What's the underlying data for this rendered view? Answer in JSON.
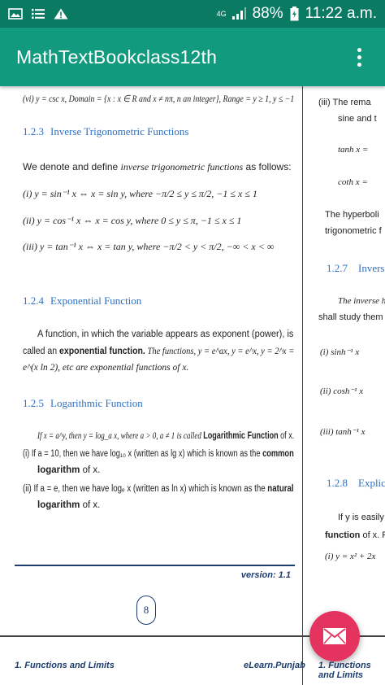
{
  "status_bar": {
    "network": "4G",
    "battery": "88%",
    "time": "11:22 a.m."
  },
  "app_bar": {
    "title": "MathTextBookclass12th"
  },
  "page": {
    "line_vi": "(vi)   y = csc x, Domain = {x : x ∈ R and x ≠ nπ, n an integer}, Range = y ≥ 1, y ≤ −1",
    "s123_num": "1.2.3",
    "s123_title": "Inverse Trigonometric Functions",
    "s123_intro_a": "We denote and define ",
    "s123_intro_b": "inverse trigonometric functions",
    "s123_intro_c": " as follows:",
    "inv_i": "(i)    y = sin⁻¹ x ⇔ x = sin y, where  −π/2 ≤ y ≤ π/2,  −1 ≤ x ≤ 1",
    "inv_ii": "(ii)   y = cos⁻¹ x ⇔ x = cos y, where  0 ≤ y ≤ π,  −1 ≤ x ≤ 1",
    "inv_iii": "(iii)  y = tan⁻¹ x ⇔ x = tan y, where  −π/2 < y < π/2,  −∞ < x < ∞",
    "s124_num": "1.2.4",
    "s124_title": "Exponential Function",
    "exp_l1": "A  function,  in  which  the  variable  appears  as  exponent  (power),  is",
    "exp_l2a": "called  an ",
    "exp_l2b": "exponential  function.",
    "exp_l2c": "  The  functions,  y = e^ax,  y = e^x,  y = 2^x = ",
    "exp_l3": "e^(x ln 2), etc are exponential functions of x.",
    "s125_num": "1.2.5",
    "s125_title": "Logarithmic Function",
    "log_l1a": "If x = a^y, then y = log_a x, where a > 0, a ≠ 1 is called ",
    "log_l1b": "Logarithmic Function",
    "log_l1c": " of x.",
    "log_i_a": "(i)    If a = 10, then we have log₁₀ x (written as lg x) which is known as the ",
    "log_i_b": "common",
    "log_i_c": "logarithm",
    "log_i_d": " of x.",
    "log_ii_a": "(ii)   If a = e, then we have logₑ x (written as ln x) which is known as the ",
    "log_ii_b": "natural",
    "log_ii_c": "logarithm",
    "log_ii_d": " of x.",
    "version": "version: 1.1",
    "page_number": "8",
    "footer_left": "1. Functions and Limits",
    "footer_right": "eLearn.Punjab"
  },
  "next_page": {
    "r1": "(iii)  The rema",
    "r2": "sine and t",
    "r3": "tanh x = ",
    "r4": "coth x = ",
    "r5": "The  hyperboli",
    "r6": "trigonometric f",
    "r7_num": "1.2.7",
    "r7_title": "Inverse",
    "r8": "The inverse hyp",
    "r9": "shall study them in",
    "r10": "(i)     sinh⁻¹ x",
    "r11": "(ii)    cosh⁻¹ x",
    "r12": "(iii)   tanh⁻¹ x",
    "r13_num": "1.2.8",
    "r13_title": "Explicit",
    "r14": "If y is easily exp",
    "r15a": "function",
    "r15b": " of x. For ex",
    "r16": "(i)    y = x² + 2x",
    "footer": "1. Functions and Limits"
  },
  "colors": {
    "status_bar": "#0b7a63",
    "app_bar": "#129a7e",
    "heading": "#2e6fc0",
    "fab": "#e4335e"
  },
  "icons": [
    "image-icon",
    "list-icon",
    "warning-icon",
    "signal-icon",
    "battery-icon",
    "overflow-menu-icon",
    "mail-icon"
  ]
}
